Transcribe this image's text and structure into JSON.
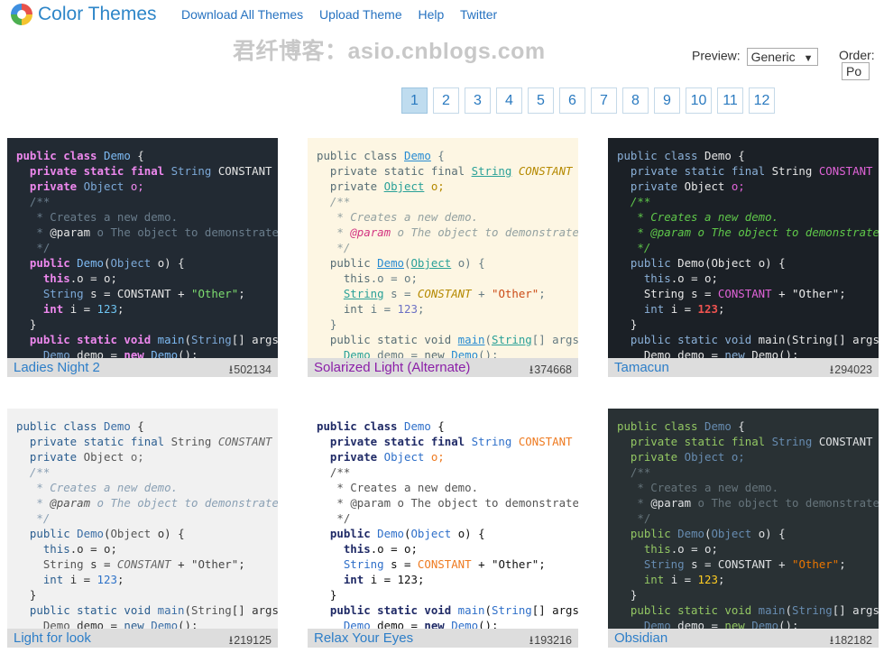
{
  "header": {
    "title": "Color Themes",
    "nav": [
      "Download All Themes",
      "Upload Theme",
      "Help",
      "Twitter"
    ],
    "watermark": "君纤博客：asio.cnblogs.com"
  },
  "controls": {
    "preview_label": "Preview:",
    "preview_value": "Generic",
    "order_label": "Order:",
    "order_value": "Po"
  },
  "pagination": {
    "pages": [
      "1",
      "2",
      "3",
      "4",
      "5",
      "6",
      "7",
      "8",
      "9",
      "10",
      "11",
      "12"
    ],
    "current": "1"
  },
  "themes": [
    {
      "name": "Ladies Night 2",
      "downloads": "502134",
      "colors": {
        "bg": "#222a33",
        "caption_bg": "#dddddd",
        "name": "#2d7ec8",
        "kw": "#ee88ee",
        "cls": "#7dbaf3",
        "type": "#7ca9d8",
        "text": "#e5e5e5",
        "comment": "#6a7d8c",
        "string": "#7ede70",
        "number": "#6ec3f0",
        "param": "#e5e5e5",
        "field": "#ee88ee",
        "const": "#e5e5e5"
      },
      "styles": {
        "type_u": false,
        "comment_i": false,
        "const_i": false,
        "kw_b": true,
        "num_b": false
      },
      "code": {
        "class_kw": "public class",
        "class_name": "Demo",
        "brace": " {",
        "field1_kw": "private static final",
        "field1_type": "String",
        "field1_name": "CONSTANT",
        "field2_kw": "private",
        "field2_type": "Object",
        "field2_name": "o;",
        "c1": "/**",
        "c2": " * Creates a new demo.",
        "c3_tag": "@param",
        "c3_rest": " o The object to demonstrate.",
        "c4": " */",
        "ctor_kw": "public",
        "ctor_name": "Demo",
        "ctor_type": "Object",
        "ctor_rest": " o) {",
        "this_kw": "this",
        "this_rest": ".o = o;",
        "s_type": "String",
        "s_rest": " s = ",
        "s_const": "CONSTANT",
        "s_plus": " + ",
        "s_str": "\"Other\"",
        "semi": ";",
        "int_kw": "int",
        "int_rest": " i = ",
        "int_num": "123",
        "close": "}",
        "main_kw": "public static void",
        "main_name": "main",
        "main_type": "String",
        "main_rest": "[] args) {",
        "last_type": "Demo",
        "last_rest": " demo = ",
        "last_new": "new",
        "last_ctor": "Demo",
        "last_end": "();"
      }
    },
    {
      "name": "Solarized Light (Alternate)",
      "downloads": "374668",
      "colors": {
        "bg": "#fdf6e3",
        "caption_bg": "#dddddd",
        "name": "#8b1fa8",
        "kw": "#586e75",
        "cls": "#268bd2",
        "type": "#2aa198",
        "text": "#657b83",
        "comment": "#93a1a1",
        "string": "#cb4b16",
        "number": "#6c71c4",
        "param": "#d33682",
        "field": "#b58900",
        "const": "#b58900"
      },
      "styles": {
        "type_u": true,
        "comment_i": true,
        "const_i": true,
        "kw_b": false,
        "num_b": false
      },
      "code": {
        "class_kw": "public class",
        "class_name": "Demo",
        "brace": " {",
        "field1_kw": "private static final",
        "field1_type": "String",
        "field1_name": "CONSTANT",
        "field2_kw": "private",
        "field2_type": "Object",
        "field2_name": "o;",
        "c1": "/**",
        "c2": " * Creates a new demo.",
        "c3_tag": "@param",
        "c3_rest": " o The object to demonstrate.",
        "c4": " */",
        "ctor_kw": "public",
        "ctor_name": "Demo",
        "ctor_type": "Object",
        "ctor_rest": " o) {",
        "this_kw": "this",
        "this_rest": ".o = o;",
        "s_type": "String",
        "s_rest": " s = ",
        "s_const": "CONSTANT",
        "s_plus": " + ",
        "s_str": "\"Other\"",
        "semi": ";",
        "int_kw": "int",
        "int_rest": " i = ",
        "int_num": "123",
        "close": "}",
        "main_kw": "public static void",
        "main_name": "main",
        "main_type": "String",
        "main_rest": "[] args) {",
        "last_type": "Demo",
        "last_rest": " demo = ",
        "last_new": "new",
        "last_ctor": "Demo",
        "last_end": "();"
      }
    },
    {
      "name": "Tamacun",
      "downloads": "294023",
      "colors": {
        "bg": "#1b2026",
        "caption_bg": "#dddddd",
        "name": "#2d7ec8",
        "kw": "#8bb1d9",
        "cls": "#e6e6e6",
        "type": "#e6e6e6",
        "text": "#e6e6e6",
        "comment": "#5fc74a",
        "string": "#f0f0f0",
        "number": "#ef5350",
        "param": "#5fc74a",
        "field": "#e063d8",
        "const": "#e063d8"
      },
      "styles": {
        "type_u": false,
        "comment_i": true,
        "const_i": false,
        "kw_b": false,
        "num_b": true
      },
      "code": {
        "class_kw": "public class",
        "class_name": "Demo",
        "brace": " {",
        "field1_kw": "private static final",
        "field1_type": "String",
        "field1_name": "CONSTANT",
        "field2_kw": "private",
        "field2_type": "Object",
        "field2_name": "o;",
        "c1": "/**",
        "c2": " * Creates a new demo.",
        "c3_tag": "@param",
        "c3_rest": " o The object to demonstrate.",
        "c4": " */",
        "ctor_kw": "public",
        "ctor_name": "Demo",
        "ctor_type": "Object",
        "ctor_rest": " o) {",
        "this_kw": "this",
        "this_rest": ".o = o;",
        "s_type": "String",
        "s_rest": " s = ",
        "s_const": "CONSTANT",
        "s_plus": " + ",
        "s_str": "\"Other\"",
        "semi": ";",
        "int_kw": "int",
        "int_rest": " i = ",
        "int_num": "123",
        "close": "}",
        "main_kw": "public static void",
        "main_name": "main",
        "main_type": "String",
        "main_rest": "[] args) {",
        "last_type": "Demo",
        "last_rest": " demo = ",
        "last_new": "new",
        "last_ctor": "Demo",
        "last_end": "();"
      }
    },
    {
      "name": "Light for look",
      "downloads": "219125",
      "colors": {
        "bg": "#f1f1f1",
        "caption_bg": "#dddddd",
        "name": "#2d7ec8",
        "kw": "#2a5d8f",
        "cls": "#3b6ea5",
        "type": "#555555",
        "text": "#333333",
        "comment": "#8aa0b4",
        "string": "#444444",
        "number": "#2e72c8",
        "param": "#555555",
        "field": "#666666",
        "const": "#666666"
      },
      "styles": {
        "type_u": false,
        "comment_i": true,
        "const_i": true,
        "kw_b": false,
        "num_b": false
      },
      "code": {
        "class_kw": "public class",
        "class_name": "Demo",
        "brace": " {",
        "field1_kw": "private static final",
        "field1_type": "String",
        "field1_name": "CONSTANT",
        "field2_kw": "private",
        "field2_type": "Object",
        "field2_name": "o;",
        "c1": "/**",
        "c2": " * Creates a new demo.",
        "c3_tag": "@param",
        "c3_rest": " o The object to demonstrate.",
        "c4": " */",
        "ctor_kw": "public",
        "ctor_name": "Demo",
        "ctor_type": "Object",
        "ctor_rest": " o) {",
        "this_kw": "this",
        "this_rest": ".o = o;",
        "s_type": "String",
        "s_rest": " s = ",
        "s_const": "CONSTANT",
        "s_plus": " + ",
        "s_str": "\"Other\"",
        "semi": ";",
        "int_kw": "int",
        "int_rest": " i = ",
        "int_num": "123",
        "close": "}",
        "main_kw": "public static void",
        "main_name": "main",
        "main_type": "String",
        "main_rest": "[] args) {",
        "last_type": "Demo",
        "last_rest": " demo = ",
        "last_new": "new",
        "last_ctor": "Demo",
        "last_end": "();"
      }
    },
    {
      "name": "Relax Your Eyes",
      "downloads": "193216",
      "colors": {
        "bg": "#ffffff",
        "caption_bg": "#dddddd",
        "name": "#2d7ec8",
        "kw": "#1f2a66",
        "cls": "#2e6fc9",
        "type": "#2e6fc9",
        "text": "#111111",
        "comment": "#555555",
        "string": "#111111",
        "number": "#111111",
        "param": "#555555",
        "field": "#ee7a20",
        "const": "#ee7a20"
      },
      "styles": {
        "type_u": false,
        "comment_i": false,
        "const_i": false,
        "kw_b": true,
        "num_b": false
      },
      "code": {
        "class_kw": "public class",
        "class_name": "Demo",
        "brace": " {",
        "field1_kw": "private static final",
        "field1_type": "String",
        "field1_name": "CONSTANT",
        "field2_kw": "private",
        "field2_type": "Object",
        "field2_name": "o;",
        "c1": "/**",
        "c2": " * Creates a new demo.",
        "c3_tag": "@param",
        "c3_rest": " o The object to demonstrate.",
        "c4": " */",
        "ctor_kw": "public",
        "ctor_name": "Demo",
        "ctor_type": "Object",
        "ctor_rest": " o) {",
        "this_kw": "this",
        "this_rest": ".o = o;",
        "s_type": "String",
        "s_rest": " s = ",
        "s_const": "CONSTANT",
        "s_plus": " + ",
        "s_str": "\"Other\"",
        "semi": ";",
        "int_kw": "int",
        "int_rest": " i = ",
        "int_num": "123",
        "close": "}",
        "main_kw": "public static void",
        "main_name": "main",
        "main_type": "String",
        "main_rest": "[] args) {",
        "last_type": "Demo",
        "last_rest": " demo = ",
        "last_new": "new",
        "last_ctor": "Demo",
        "last_end": "();"
      }
    },
    {
      "name": "Obsidian",
      "downloads": "182182",
      "colors": {
        "bg": "#293134",
        "caption_bg": "#dddddd",
        "name": "#2d7ec8",
        "kw": "#93c763",
        "cls": "#678cb1",
        "type": "#678cb1",
        "text": "#e0e2e4",
        "comment": "#66747b",
        "string": "#ec7600",
        "number": "#ffcd22",
        "param": "#e0e2e4",
        "field": "#678cb1",
        "const": "#e0e2e4"
      },
      "styles": {
        "type_u": false,
        "comment_i": false,
        "const_i": false,
        "kw_b": false,
        "num_b": false
      },
      "code": {
        "class_kw": "public class",
        "class_name": "Demo",
        "brace": " {",
        "field1_kw": "private static final",
        "field1_type": "String",
        "field1_name": "CONSTANT",
        "field2_kw": "private",
        "field2_type": "Object",
        "field2_name": "o;",
        "c1": "/**",
        "c2": " * Creates a new demo.",
        "c3_tag": "@param",
        "c3_rest": " o The object to demonstrate.",
        "c4": " */",
        "ctor_kw": "public",
        "ctor_name": "Demo",
        "ctor_type": "Object",
        "ctor_rest": " o) {",
        "this_kw": "this",
        "this_rest": ".o = o;",
        "s_type": "String",
        "s_rest": " s = ",
        "s_const": "CONSTANT",
        "s_plus": " + ",
        "s_str": "\"Other\"",
        "semi": ";",
        "int_kw": "int",
        "int_rest": " i = ",
        "int_num": "123",
        "close": "}",
        "main_kw": "public static void",
        "main_name": "main",
        "main_type": "String",
        "main_rest": "[] args) {",
        "last_type": "Demo",
        "last_rest": " demo = ",
        "last_new": "new",
        "last_ctor": "Demo",
        "last_end": "();"
      }
    }
  ]
}
